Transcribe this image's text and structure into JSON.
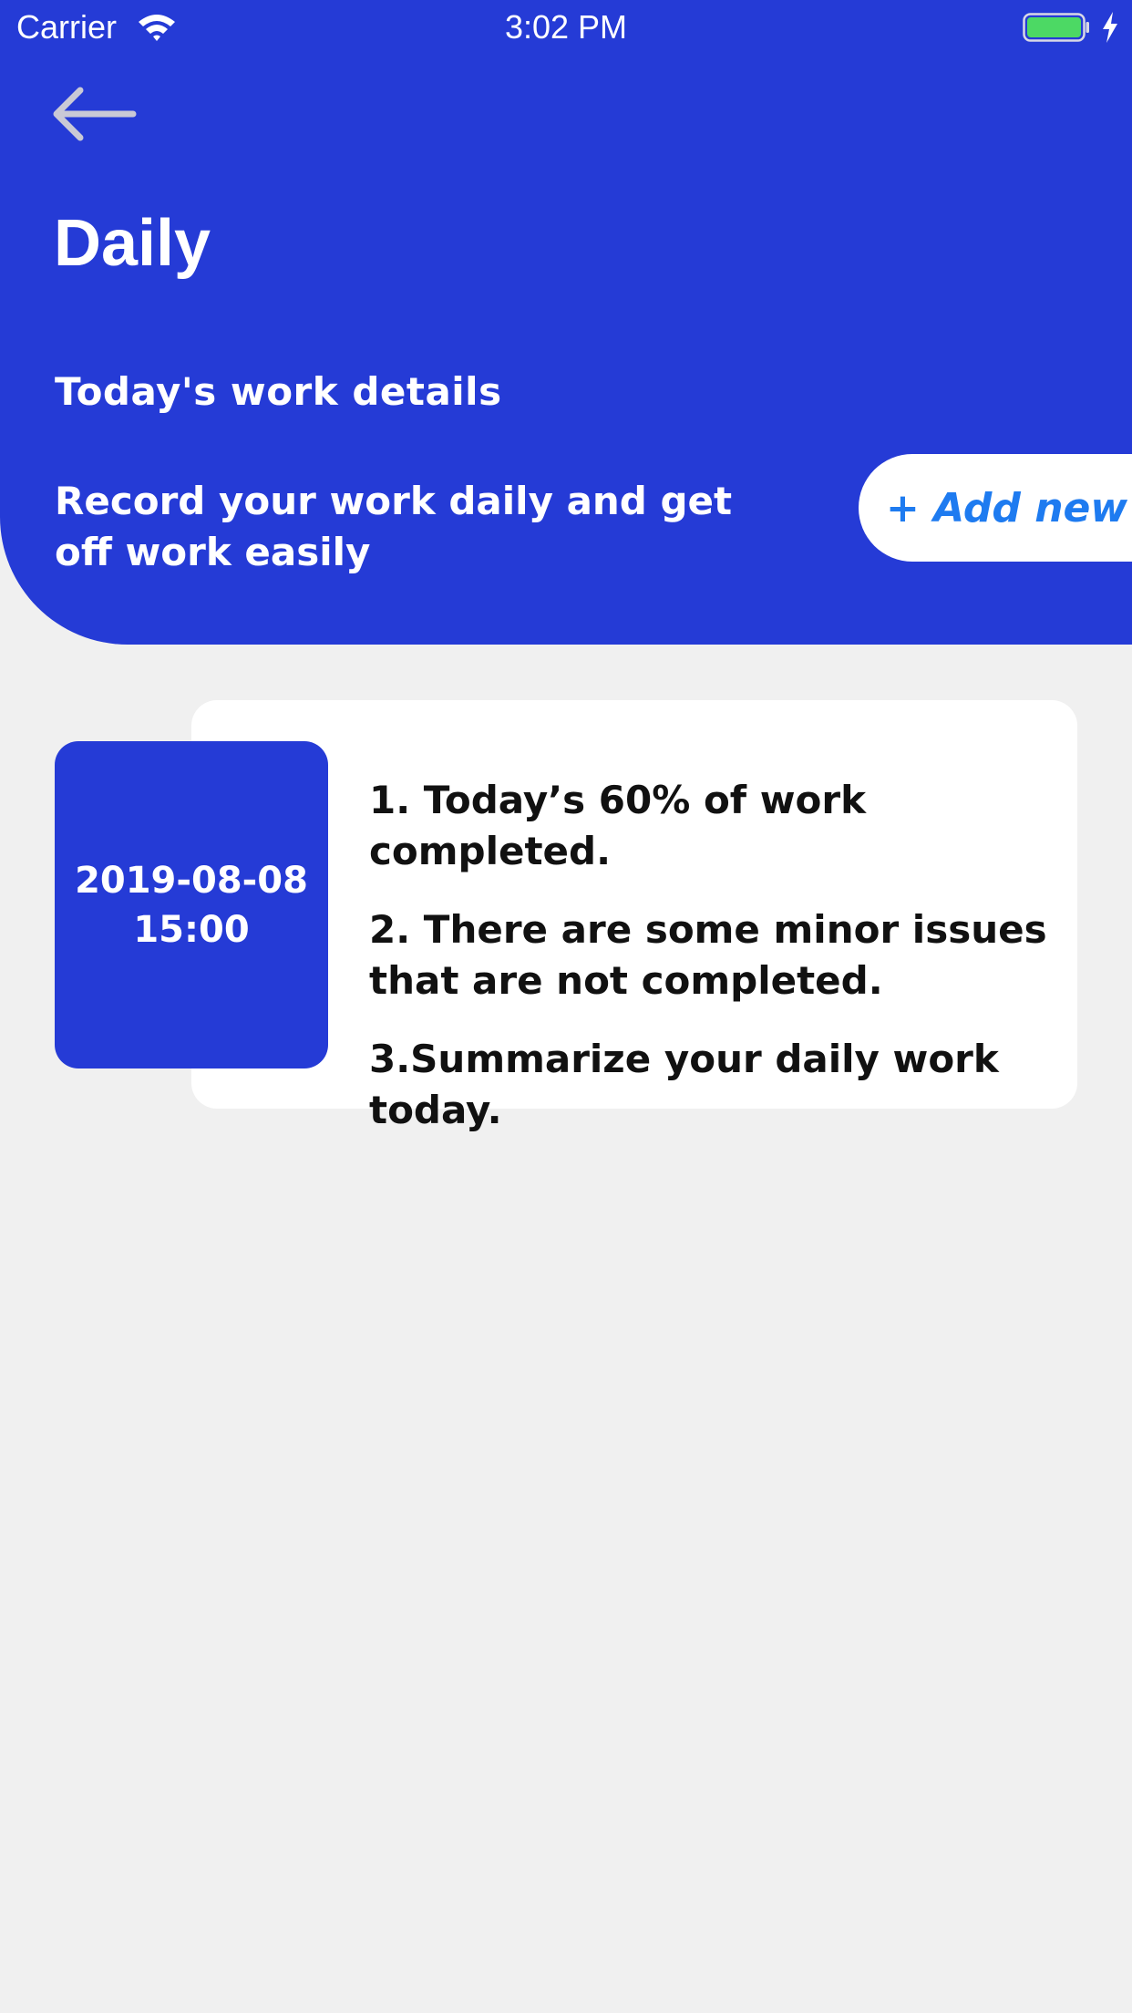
{
  "status_bar": {
    "carrier": "Carrier",
    "time": "3:02 PM",
    "wifi_icon": "wifi-icon",
    "battery_icon": "battery-icon",
    "charging_icon": "charging-bolt-icon",
    "battery_color": "#4cd964"
  },
  "header": {
    "back_icon": "back-arrow-icon",
    "title": "Daily",
    "subtitle": "Today's work details",
    "description": "Record your work daily and get off work easily",
    "add_button_label": "+ Add new",
    "background_color": "#253bd6",
    "accent_color": "#1e7bf0"
  },
  "entries": [
    {
      "date": "2019-08-08",
      "time": "15:00",
      "lines": [
        "1. Today’s 60% of work completed.",
        "2. There are some minor issues that are not completed.",
        "3.Summarize your daily work today."
      ]
    }
  ]
}
